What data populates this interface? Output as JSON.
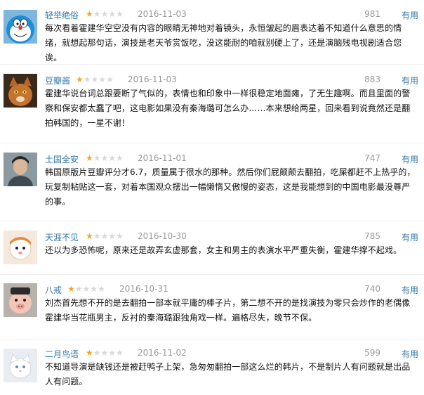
{
  "reviews": [
    {
      "user": "轻举绝俗",
      "rating": 1,
      "star_symbol": "★",
      "date": "2016-11-03",
      "votes": "981",
      "useful_label": "有用",
      "text": "每次看着霍建华空空没有内容的眼睛无神地对着镜头，永恒皱起的眉表达着不知道什么意思的情绪，就想起那句话，演技是老天爷赏饭吃，没这能耐的咱就别硬上了，还是演脑残电视剧适合您诶。",
      "avatar": "doraemon-avatar"
    },
    {
      "user": "豆瓣酱",
      "rating": 1,
      "star_symbol": "★",
      "date": "2016-11-03",
      "votes": "883",
      "useful_label": "有用",
      "text": "霍建华说台词总跟要断了气似的，表情也和印象中一样很稳定地面瘫，了无生趣啊。而且里面的警察和保安都太蠢了吧，这电影如果没有秦海璐可怎么办……本来想给两星，回来看到说竟然还是翻拍韩国的，一星不谢！",
      "avatar": "cat-avatar"
    },
    {
      "user": "土国全安",
      "rating": 1,
      "star_symbol": "★",
      "date": "2016-11-01",
      "votes": "747",
      "useful_label": "有用",
      "text": "韩国原版片豆瓣评分才6.7，质量属于很水的那种。然后你们屁颠颠去翻拍，吃屎都赶不上热乎的，玩复制粘贴这一套，对着本国观众摆出一幅懒惰又傲慢的姿态，这是我能想到的中国电影最没尊严的事。",
      "avatar": "portrait-avatar"
    },
    {
      "user": "天涯不见",
      "rating": 1,
      "star_symbol": "★",
      "date": "2016-10-30",
      "votes": "785",
      "useful_label": "有用",
      "text": "还以为多恐怖呢，原来还是故弄玄虚那套，女主和男主的表演水平严重失衡，霍建华撑不起戏。",
      "avatar": "cartoon-avatar"
    },
    {
      "user": "八戒",
      "rating": 1,
      "star_symbol": "★",
      "date": "2016-10-31",
      "votes": "740",
      "useful_label": "有用",
      "text": "刘杰首先想不开的是去翻拍一部本就平庸的棒子片，第二想不开的是找演技为零只会炒作的老偶像霍建华当花瓶男主，反衬的秦海璐跟独角戏一样。遍格尽失，晚节不保。",
      "avatar": "pig-avatar"
    },
    {
      "user": "二月鸟语",
      "rating": 1,
      "star_symbol": "★",
      "date": "2016-11-02",
      "votes": "599",
      "useful_label": "有用",
      "text": "不知道导演是缺钱还是被赶鸭子上架，急匆匆翻拍一部这么烂的韩片，不是制片人有问题就是出品人有问题。",
      "avatar": "white-cat-avatar"
    }
  ],
  "colors": {
    "link": "#3377aa",
    "meta": "#999999",
    "star_on": "#f5a623",
    "star_off": "#d8d8d8"
  }
}
